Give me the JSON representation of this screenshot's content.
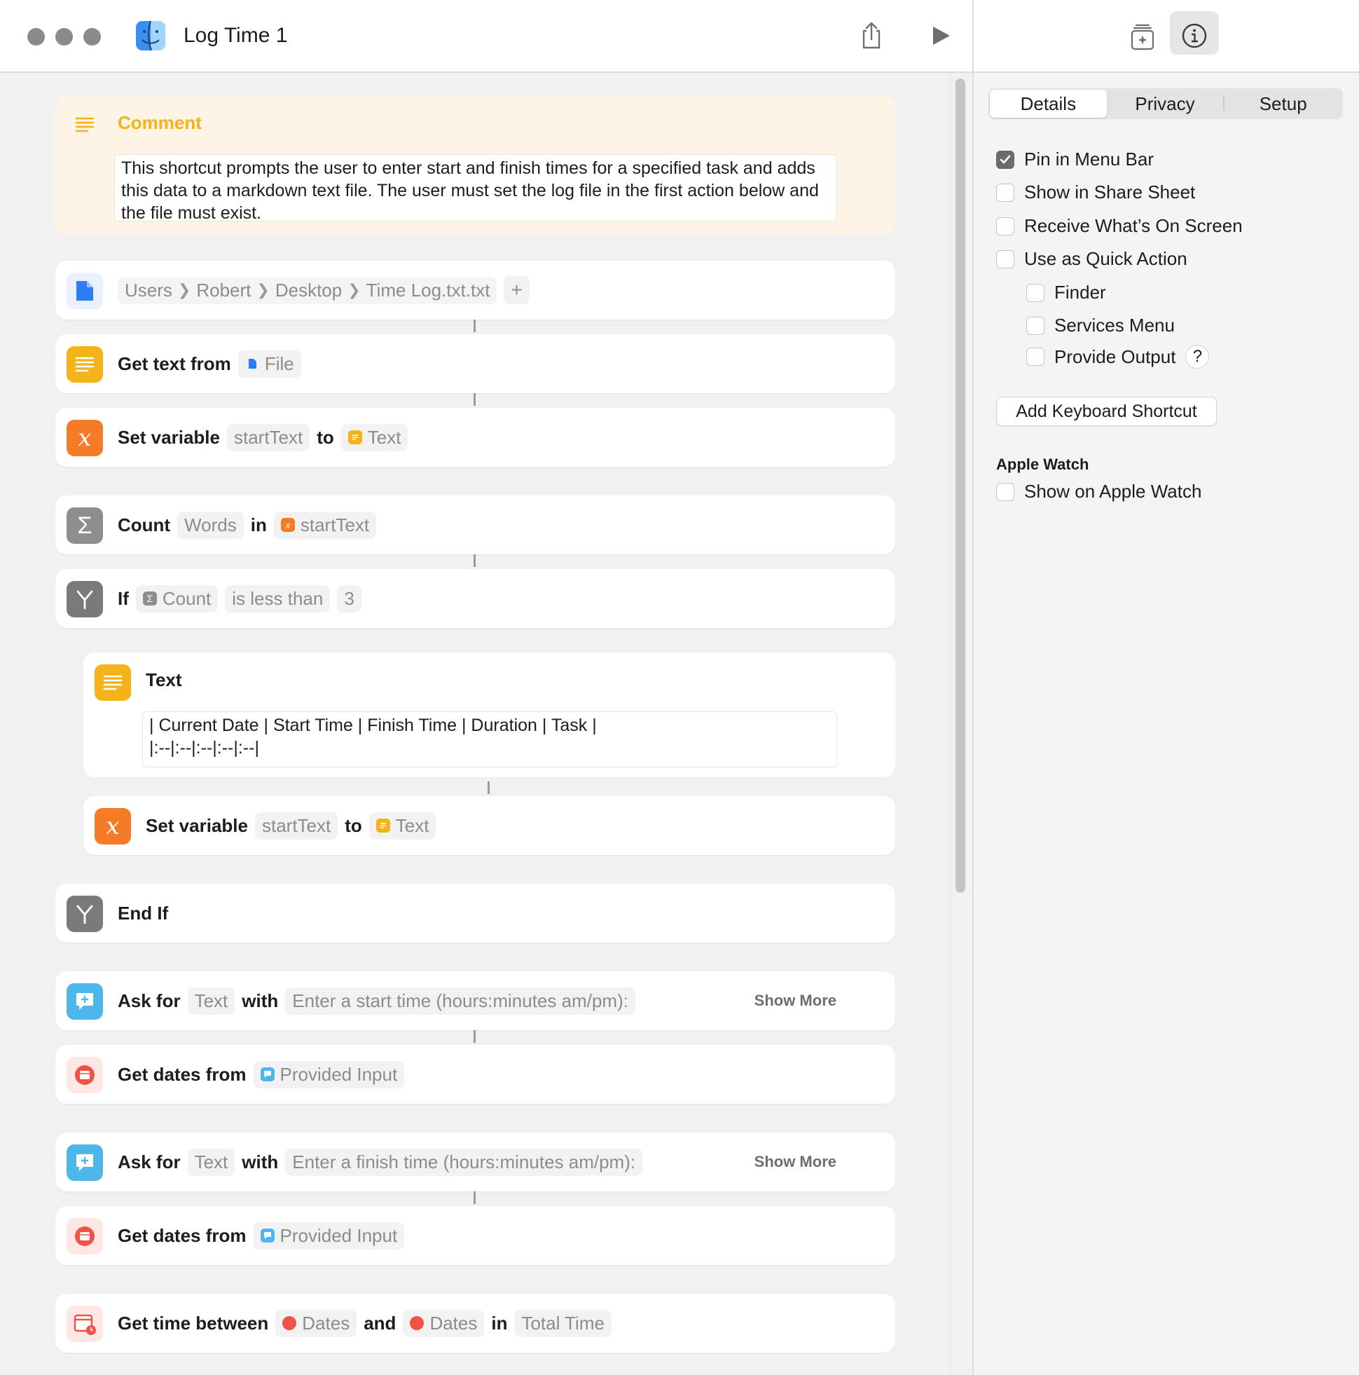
{
  "window": {
    "title": "Log Time 1"
  },
  "comment": {
    "label": "Comment",
    "text": "This shortcut prompts the user to enter start and finish times for a specified task and adds this data to a markdown text file. The user must set the log file in the first action below and the file must exist."
  },
  "actions": {
    "file_path": {
      "crumbs": [
        "Users",
        "Robert",
        "Desktop",
        "Time Log.txt.txt"
      ]
    },
    "get_text": {
      "keyword": "Get text from",
      "token": "File"
    },
    "set_var_1": {
      "keyword": "Set variable",
      "variable": "startText",
      "to": "to",
      "token": "Text"
    },
    "count": {
      "keyword": "Count",
      "unit": "Words",
      "in": "in",
      "token": "startText"
    },
    "if": {
      "keyword": "If",
      "token": "Count",
      "condition": "is less than",
      "value": "3"
    },
    "text": {
      "title": "Text",
      "content": "| Current Date | Start Time | Finish Time | Duration | Task |\n|:--|:--|:--|:--|:--|"
    },
    "set_var_2": {
      "keyword": "Set variable",
      "variable": "startText",
      "to": "to",
      "token": "Text"
    },
    "end_if": {
      "keyword": "End If"
    },
    "ask_start": {
      "keyword": "Ask for",
      "type": "Text",
      "with": "with",
      "prompt": "Enter a start time (hours:minutes am/pm):",
      "show_more": "Show More"
    },
    "dates_start": {
      "keyword": "Get dates from",
      "token": "Provided Input"
    },
    "ask_finish": {
      "keyword": "Ask for",
      "type": "Text",
      "with": "with",
      "prompt": "Enter a finish time (hours:minutes am/pm):",
      "show_more": "Show More"
    },
    "dates_finish": {
      "keyword": "Get dates from",
      "token": "Provided Input"
    },
    "time_between": {
      "keyword": "Get time between",
      "token1": "Dates",
      "and": "and",
      "token2": "Dates",
      "in": "in",
      "unit": "Total Time"
    }
  },
  "sidebar": {
    "tabs": [
      "Details",
      "Privacy",
      "Setup"
    ],
    "active_tab": "Details",
    "options": {
      "pin_menu_bar": {
        "label": "Pin in Menu Bar",
        "checked": true
      },
      "share_sheet": {
        "label": "Show in Share Sheet",
        "checked": false
      },
      "on_screen": {
        "label": "Receive What’s On Screen",
        "checked": false
      },
      "quick_action": {
        "label": "Use as Quick Action",
        "checked": false
      },
      "finder": {
        "label": "Finder",
        "checked": false
      },
      "services_menu": {
        "label": "Services Menu",
        "checked": false
      },
      "provide_output": {
        "label": "Provide Output",
        "checked": false,
        "help": "?"
      }
    },
    "keyboard_button": "Add Keyboard Shortcut",
    "apple_watch": {
      "heading": "Apple Watch",
      "show_on_watch": {
        "label": "Show on Apple Watch",
        "checked": false
      }
    }
  },
  "colors": {
    "text_action": "#f5b31a",
    "variable_action": "#f57b26",
    "math_action": "#8e8e8e",
    "scripting_action": "#7a7a7a",
    "ask_action": "#4db6ea",
    "calendar_action": "#f05247",
    "file_action": "#2d7cf6",
    "comment_bg": "#fdf4e5"
  }
}
